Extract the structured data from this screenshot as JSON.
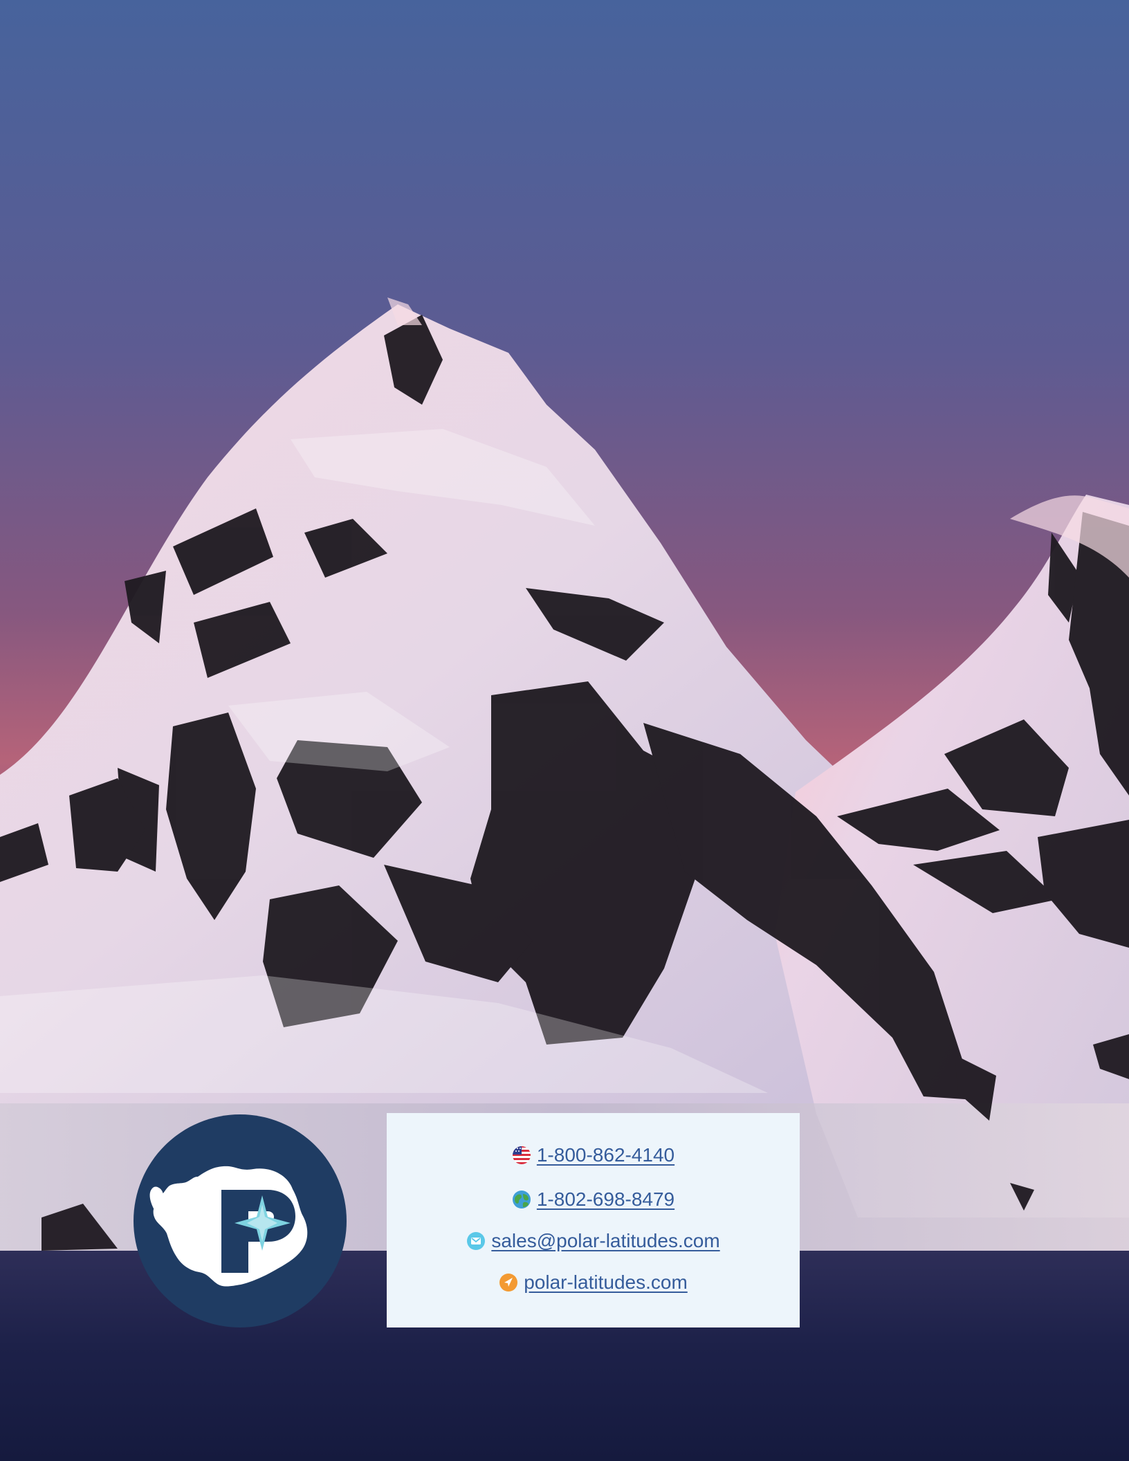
{
  "contact": {
    "us_phone": "1-800-862-4140",
    "intl_phone": "1-802-698-8479",
    "email": "sales@polar-latitudes.com",
    "website": "polar-latitudes.com"
  },
  "icons": {
    "us_phone": "us-flag-icon",
    "intl_phone": "globe-icon",
    "email": "mail-icon",
    "website": "navigation-arrow-icon"
  },
  "colors": {
    "logo_blue": "#1f3c63",
    "link_blue": "#355c9b",
    "contact_box": "#edf5fb",
    "website_orange": "#f39a32"
  }
}
